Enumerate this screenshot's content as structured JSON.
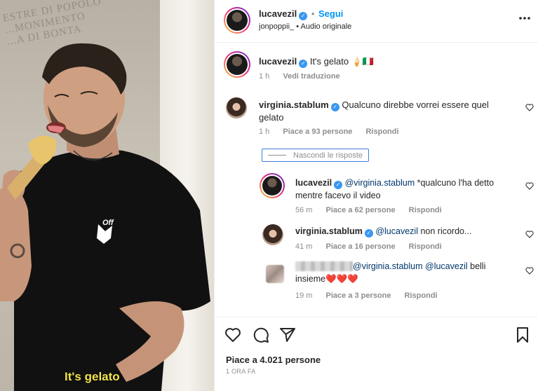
{
  "photo": {
    "engraved_lines": [
      "ESTRE DI POPOLO",
      "...MONIMENTO",
      "...A DI BONTA"
    ],
    "caption_overlay": "It's gelato",
    "shirt_logo": "Off"
  },
  "header": {
    "username": "lucavezil",
    "follow_label": "Segui",
    "audio_user": "jonpoppii_",
    "audio_separator": "•",
    "audio_label": "Audio originale",
    "more_icon": "more-horizontal-icon"
  },
  "caption": {
    "username": "lucavezil",
    "text": "It's gelato 🍦🇮🇹",
    "time": "1 h",
    "translate": "Vedi traduzione"
  },
  "comments": [
    {
      "username": "virginia.stablum",
      "text_line1": "Qualcuno direbbe vorrei essere quel",
      "text_line2": "gelato",
      "time": "1 h",
      "likes": "Piace a 93 persone",
      "reply": "Rispondi"
    }
  ],
  "hide_replies": "Nascondi le risposte",
  "replies": [
    {
      "username": "lucavezil",
      "mention": "@virginia.stablum",
      "text_line1": " *qualcuno l'ha detto",
      "text_line2": "mentre facevo il video",
      "time": "56 m",
      "likes": "Piace a 62 persone",
      "reply": "Rispondi"
    },
    {
      "username": "virginia.stablum",
      "mention": "@lucavezil",
      "text_line1": " non ricordo...",
      "time": "41 m",
      "likes": "Piace a 16 persone",
      "reply": "Rispondi"
    },
    {
      "mention1": "@virginia.stablum",
      "mention2": "@lucavezil",
      "text_line1": " belli",
      "text_line2": "insieme❤️❤️❤️",
      "time": "19 m",
      "likes": "Piace a 3 persone",
      "reply": "Rispondi"
    }
  ],
  "footer": {
    "likes": "Piace a 4.021 persone",
    "timestamp": "1 ORA FA"
  },
  "colors": {
    "accent_blue": "#0095f6",
    "verified_blue": "#3897f0",
    "mention": "#00376b",
    "overlay_yellow": "#f2e34a"
  }
}
